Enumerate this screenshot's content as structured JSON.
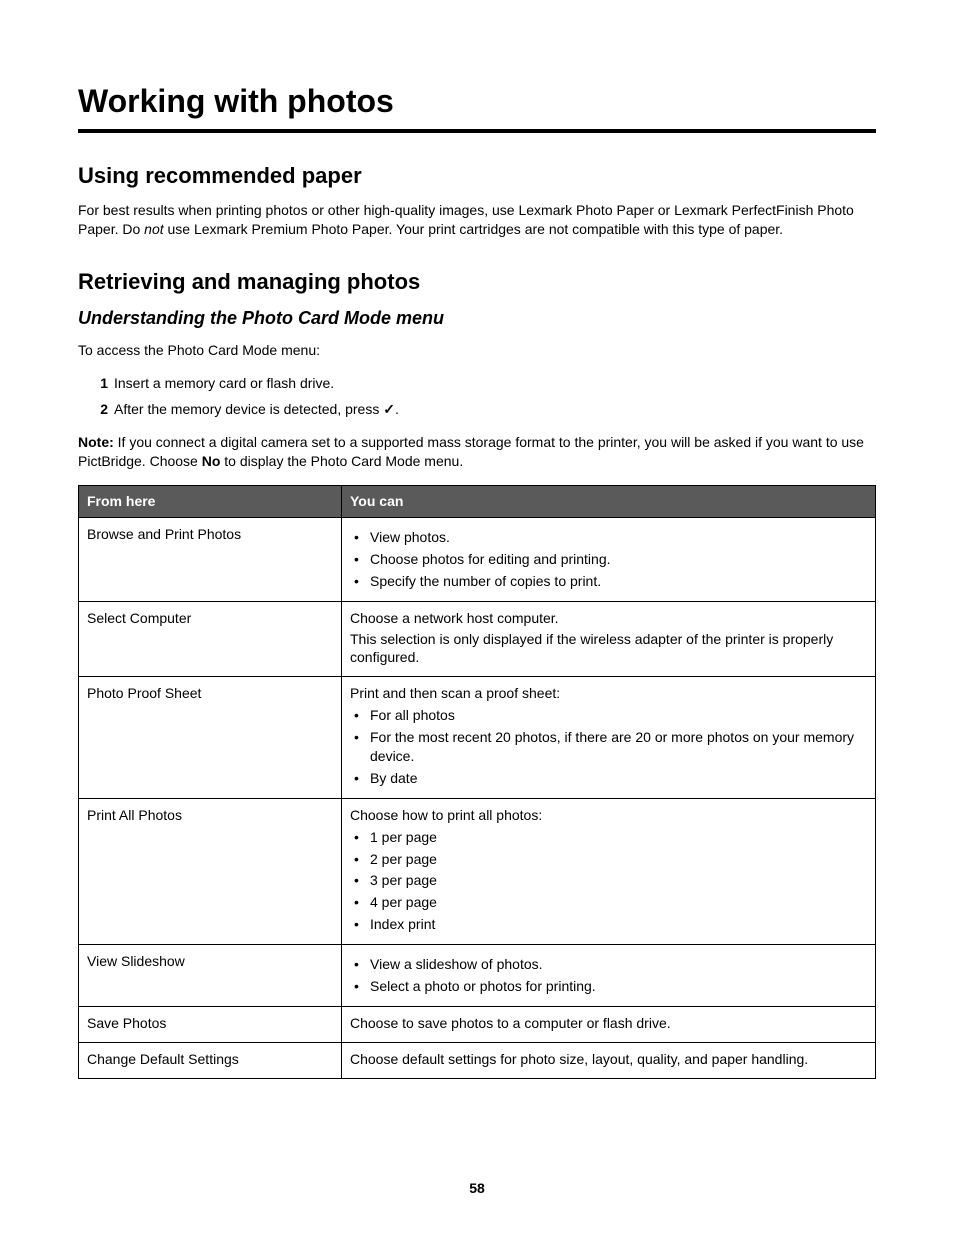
{
  "page_title": "Working with photos",
  "section_paper": {
    "heading": "Using recommended paper",
    "body_pre": "For best results when printing photos or other high-quality images, use Lexmark Photo Paper or Lexmark PerfectFinish Photo Paper. Do ",
    "body_italic": "not",
    "body_post": " use Lexmark Premium Photo Paper. Your print cartridges are not compatible with this type of paper."
  },
  "section_retrieve": {
    "heading": "Retrieving and managing photos",
    "subheading": "Understanding the Photo Card Mode menu",
    "intro": "To access the Photo Card Mode menu:",
    "steps": [
      "Insert a memory card or flash drive.",
      "After the memory device is detected, press "
    ],
    "step2_symbol": "✓",
    "step2_tail": ".",
    "note_label": "Note:",
    "note_body_pre": " If you connect a digital camera set to a supported mass storage format to the printer, you will be asked if you want to use PictBridge. Choose ",
    "note_bold": "No",
    "note_body_post": " to display the Photo Card Mode menu."
  },
  "table": {
    "head_left": "From here",
    "head_right": "You can",
    "rows": [
      {
        "left": "Browse and Print Photos",
        "right": {
          "bullets": [
            "View photos.",
            "Choose photos for editing and printing.",
            "Specify the number of copies to print."
          ]
        }
      },
      {
        "left": "Select Computer",
        "right": {
          "lines": [
            "Choose a network host computer.",
            "This selection is only displayed if the wireless adapter of the printer is properly configured."
          ]
        }
      },
      {
        "left": "Photo Proof Sheet",
        "right": {
          "intro": "Print and then scan a proof sheet:",
          "bullets": [
            "For all photos",
            "For the most recent 20 photos, if there are 20 or more photos on your memory device.",
            "By date"
          ]
        }
      },
      {
        "left": "Print All Photos",
        "right": {
          "intro": "Choose how to print all photos:",
          "bullets": [
            "1 per page",
            "2 per page",
            "3 per page",
            "4 per page",
            "Index print"
          ]
        }
      },
      {
        "left": "View Slideshow",
        "right": {
          "bullets": [
            "View a slideshow of photos.",
            "Select a photo or photos for printing."
          ]
        }
      },
      {
        "left": "Save Photos",
        "right": {
          "lines": [
            "Choose to save photos to a computer or flash drive."
          ]
        }
      },
      {
        "left": "Change Default Settings",
        "right": {
          "lines": [
            "Choose default settings for photo size, layout, quality, and paper handling."
          ]
        }
      }
    ]
  },
  "page_number": "58"
}
